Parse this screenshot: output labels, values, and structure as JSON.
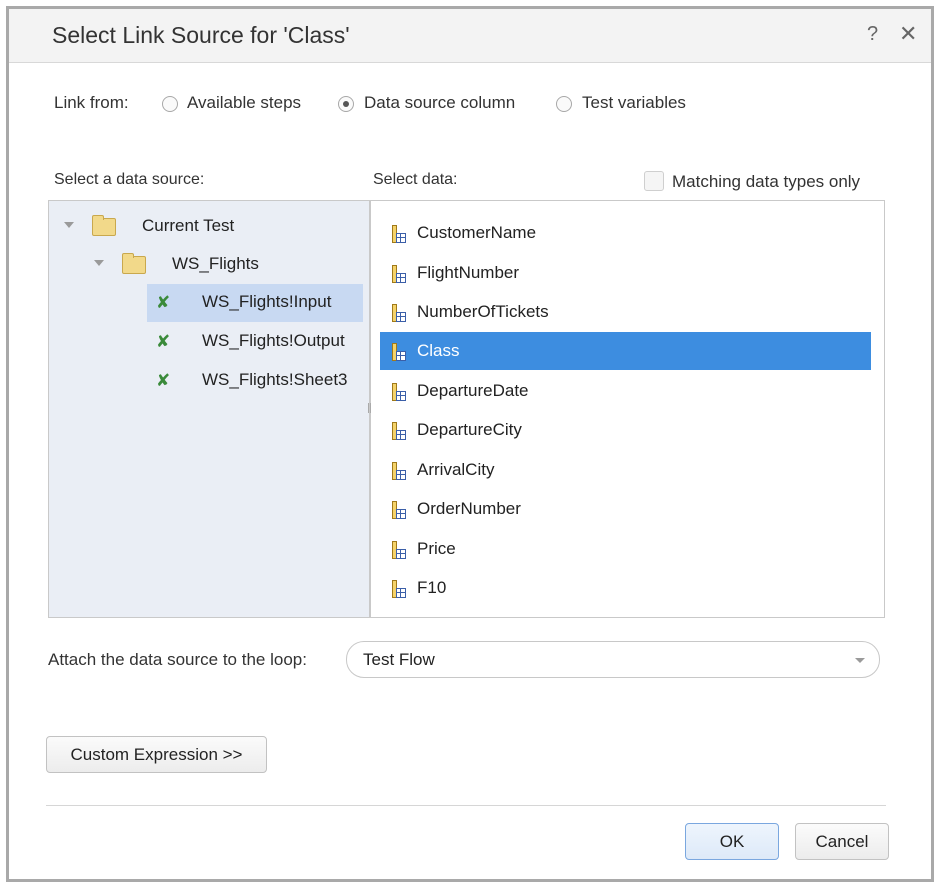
{
  "dialog": {
    "title": "Select Link Source for 'Class'",
    "help": "?",
    "close": "✕"
  },
  "link_from": {
    "label": "Link from:",
    "options": [
      "Available steps",
      "Data source column",
      "Test variables"
    ],
    "selected": "Data source column"
  },
  "data_source": {
    "label": "Select a data source:",
    "tree": [
      {
        "label": "Current Test",
        "icon": "folder-icon"
      },
      {
        "label": "WS_Flights",
        "icon": "folder-icon"
      },
      {
        "label": "WS_Flights!Input",
        "icon": "excel-icon",
        "selected": true
      },
      {
        "label": "WS_Flights!Output",
        "icon": "excel-icon"
      },
      {
        "label": "WS_Flights!Sheet3",
        "icon": "excel-icon"
      }
    ]
  },
  "select_data": {
    "label": "Select data:",
    "matching_label": "Matching data types only",
    "matching_checked": false,
    "columns": [
      "CustomerName",
      "FlightNumber",
      "NumberOfTickets",
      "Class",
      "DepartureDate",
      "DepartureCity",
      "ArrivalCity",
      "OrderNumber",
      "Price",
      "F10"
    ],
    "selected": "Class"
  },
  "attach": {
    "label": "Attach the data source to the loop:",
    "value": "Test Flow"
  },
  "buttons": {
    "custom_expression": "Custom Expression >>",
    "ok": "OK",
    "cancel": "Cancel"
  },
  "colors": {
    "selection": "#3d8de0",
    "tree_selection": "#c8d9f2",
    "tree_bg": "#eaeef5"
  }
}
